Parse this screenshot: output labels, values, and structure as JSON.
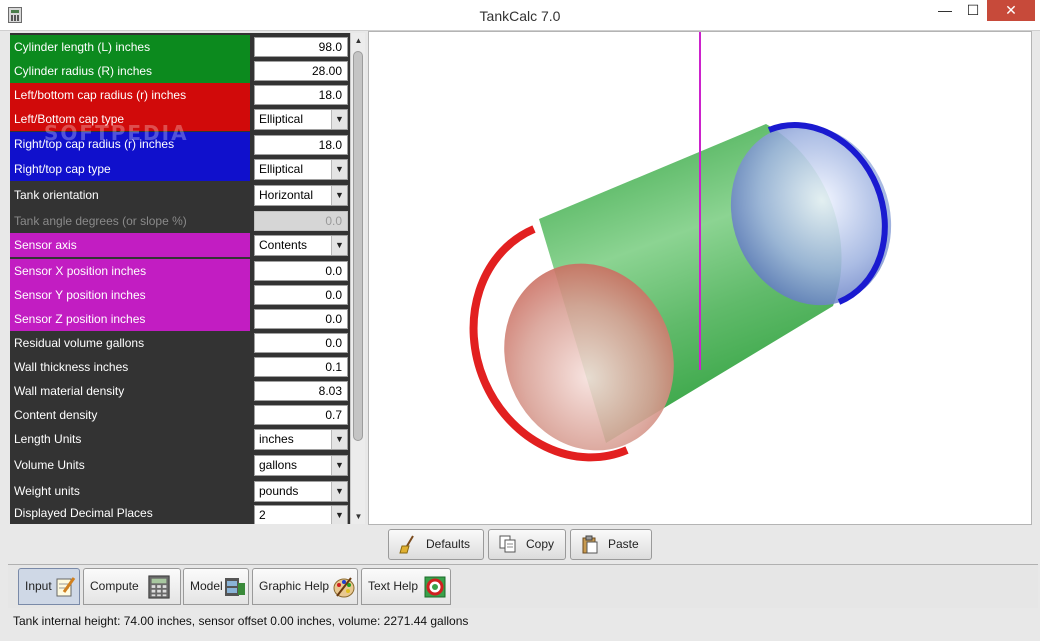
{
  "window": {
    "title": "TankCalc 7.0",
    "minimize": "—",
    "maximize": "☐",
    "close": "✕"
  },
  "panel": {
    "watermark": "SOFTPEDIA",
    "rows": [
      {
        "label": "Cylinder length (L) inches",
        "value": "98.0",
        "kind": "field",
        "color": "#0c8a1e"
      },
      {
        "label": "Cylinder radius (R) inches",
        "value": "28.00",
        "kind": "field",
        "color": "#0c8a1e"
      },
      {
        "label": "Left/bottom cap radius (r) inches",
        "value": "18.0",
        "kind": "field",
        "color": "#d10a0a"
      },
      {
        "label": "Left/Bottom cap type",
        "value": "Elliptical",
        "kind": "select",
        "color": "#d10a0a"
      },
      {
        "label": "Right/top cap radius (r) inches",
        "value": "18.0",
        "kind": "field",
        "color": "#1010cc"
      },
      {
        "label": "Right/top cap type",
        "value": "Elliptical",
        "kind": "select",
        "color": "#1010cc"
      },
      {
        "label": "Tank orientation",
        "value": "Horizontal",
        "kind": "select"
      },
      {
        "label": "Tank angle degrees (or slope %)",
        "value": "0.0",
        "kind": "field",
        "disabled": true
      },
      {
        "label": "Sensor axis",
        "value": "Contents",
        "kind": "select",
        "color": "#c21dc2"
      },
      {
        "label": "Sensor X position inches",
        "value": "0.0",
        "kind": "field",
        "color": "#c21dc2"
      },
      {
        "label": "Sensor Y position inches",
        "value": "0.0",
        "kind": "field",
        "color": "#c21dc2"
      },
      {
        "label": "Sensor Z position inches",
        "value": "0.0",
        "kind": "field",
        "color": "#c21dc2"
      },
      {
        "label": "Residual volume gallons",
        "value": "0.0",
        "kind": "field"
      },
      {
        "label": "Wall thickness inches",
        "value": "0.1",
        "kind": "field"
      },
      {
        "label": "Wall material density",
        "value": "8.03",
        "kind": "field"
      },
      {
        "label": "Content density",
        "value": "0.7",
        "kind": "field"
      },
      {
        "label": "Length Units",
        "value": "inches",
        "kind": "select"
      },
      {
        "label": "Volume Units",
        "value": "gallons",
        "kind": "select"
      },
      {
        "label": "Weight units",
        "value": "pounds",
        "kind": "select"
      },
      {
        "label": "Displayed Decimal Places",
        "value": "2",
        "kind": "select"
      }
    ]
  },
  "buttons": {
    "defaults": "Defaults",
    "copy": "Copy",
    "paste": "Paste"
  },
  "tabs": {
    "input": "Input",
    "compute": "Compute",
    "model": "Model",
    "graphic_help": "Graphic Help",
    "text_help": "Text Help"
  },
  "status": "Tank internal height: 74.00 inches, sensor offset 0.00 inches, volume: 2271.44 gallons",
  "colors": {
    "cylinder": "#1fa53a",
    "left_cap": "#e01414",
    "right_cap": "#1a1ad0",
    "sensor_line": "#cc22cc"
  }
}
